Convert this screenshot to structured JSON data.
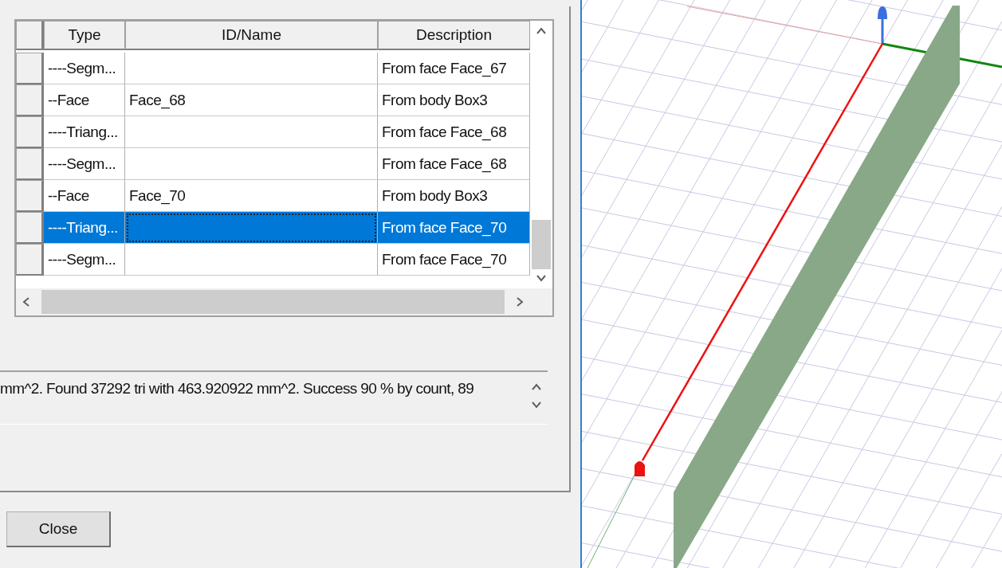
{
  "table": {
    "columns": [
      "Type",
      "ID/Name",
      "Description"
    ],
    "rows": [
      {
        "type": "----Segm...",
        "name": "",
        "description": "From face Face_67",
        "selected": false
      },
      {
        "type": "--Face",
        "name": "Face_68",
        "description": "From body Box3",
        "selected": false
      },
      {
        "type": "----Triang...",
        "name": "",
        "description": "From face Face_68",
        "selected": false
      },
      {
        "type": "----Segm...",
        "name": "",
        "description": "From face Face_68",
        "selected": false
      },
      {
        "type": "--Face",
        "name": "Face_70",
        "description": "From body Box3",
        "selected": false
      },
      {
        "type": "----Triang...",
        "name": "",
        "description": "From face Face_70",
        "selected": true
      },
      {
        "type": "----Segm...",
        "name": "",
        "description": "From face Face_70",
        "selected": false
      }
    ]
  },
  "message": "mm^2. Found 37292 tri with 463.920922 mm^2. Success 90 % by count, 89",
  "buttons": [
    "Close"
  ]
}
